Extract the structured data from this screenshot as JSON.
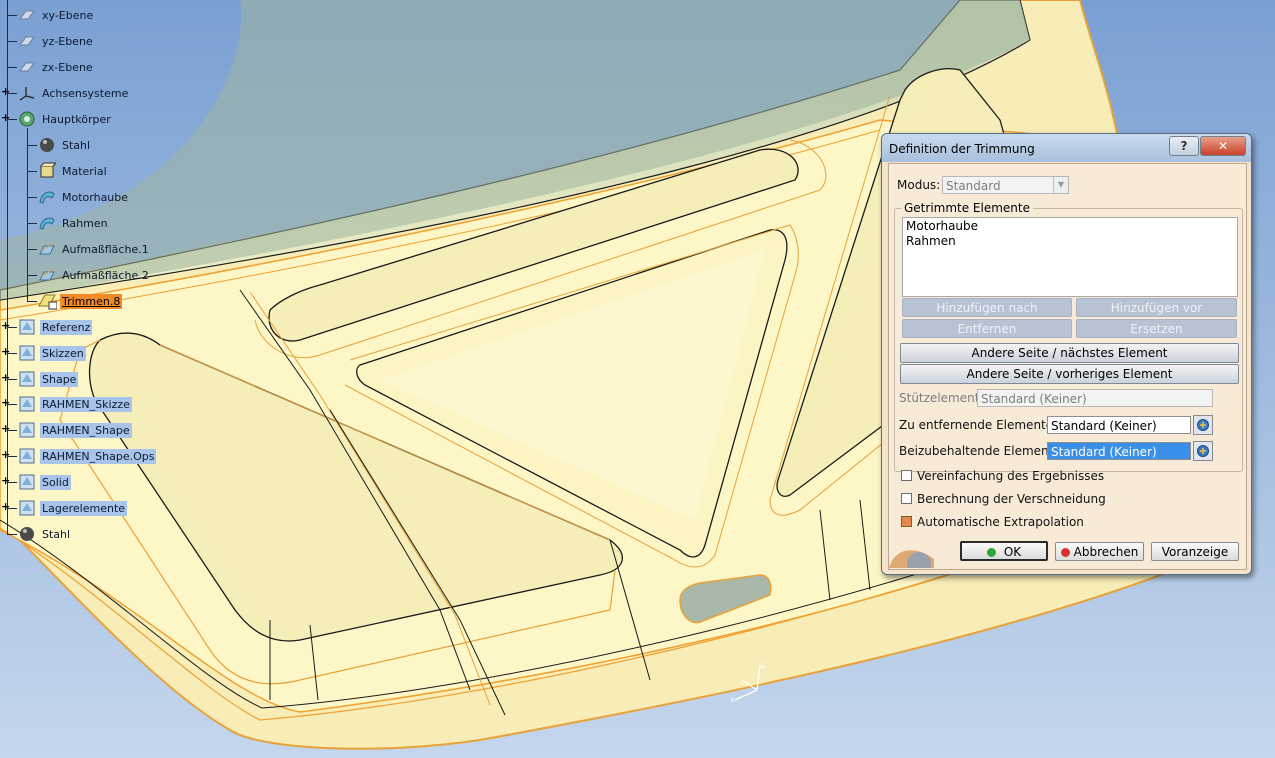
{
  "tree": {
    "items": [
      {
        "label": "xy-Ebene",
        "icon": "plane-icon"
      },
      {
        "label": "yz-Ebene",
        "icon": "plane-icon"
      },
      {
        "label": "zx-Ebene",
        "icon": "plane-icon"
      },
      {
        "label": "Achsensysteme",
        "icon": "axis-system-icon"
      },
      {
        "label": "Hauptkörper",
        "icon": "gear-body-icon"
      },
      {
        "label": "Stahl",
        "icon": "material-sphere-icon"
      },
      {
        "label": "Material",
        "icon": "material-box-icon"
      },
      {
        "label": "Motorhaube",
        "icon": "surface-icon"
      },
      {
        "label": "Rahmen",
        "icon": "surface-icon"
      },
      {
        "label": "Aufmaßfläche.1",
        "icon": "offset-surface-icon"
      },
      {
        "label": "Aufmaßfläche.2",
        "icon": "offset-surface-icon"
      },
      {
        "label": "Trimmen.8",
        "icon": "trim-icon"
      },
      {
        "label": "Referenz",
        "icon": "geometric-set-icon"
      },
      {
        "label": "Skizzen",
        "icon": "geometric-set-icon"
      },
      {
        "label": "Shape",
        "icon": "geometric-set-icon"
      },
      {
        "label": "RAHMEN_Skizze",
        "icon": "geometric-set-icon"
      },
      {
        "label": "RAHMEN_Shape",
        "icon": "geometric-set-icon"
      },
      {
        "label": "RAHMEN_Shape.Ops",
        "icon": "geometric-set-icon"
      },
      {
        "label": "Solid",
        "icon": "geometric-set-icon"
      },
      {
        "label": "Lagerelemente",
        "icon": "geometric-set-icon"
      },
      {
        "label": "Stahl",
        "icon": "material-sphere-icon"
      }
    ]
  },
  "dialog": {
    "title": "Definition der Trimmung",
    "help_glyph": "?",
    "close_glyph": "✕",
    "modus_label": "Modus:",
    "modus_value": "Standard",
    "group_label": "Getrimmte Elemente",
    "trimmed_elements": [
      "Motorhaube",
      "Rahmen"
    ],
    "add_after": "Hinzufügen nach",
    "add_before": "Hinzufügen vor",
    "remove": "Entfernen",
    "replace": "Ersetzen",
    "other_side_next": "Andere Seite / nächstes Element",
    "other_side_prev": "Andere Seite / vorheriges Element",
    "support_label": "Stützelement:",
    "support_value": "Standard (Keiner)",
    "remove_elements_label": "Zu entfernende Elemente:",
    "remove_elements_value": "Standard (Keiner)",
    "keep_elements_label": "Beizubehaltende Elemente:",
    "keep_elements_value": "Standard (Keiner)",
    "simplify_label": "Vereinfachung des Ergebnisses",
    "simplify_checked": false,
    "intersection_label": "Berechnung der Verschneidung",
    "intersection_checked": false,
    "extrapolation_label": "Automatische Extrapolation",
    "extrapolation_checked": true,
    "ok": "OK",
    "cancel": "Abbrechen",
    "preview": "Voranzeige"
  },
  "colors": {
    "background_top": "#7ea3d3",
    "background_bottom": "#c2d4ea",
    "surface_fill": "#fdf7c4",
    "edge_orange": "#f0a030",
    "selection_blue": "#3a8fe8",
    "active_orange": "#f28a2a"
  }
}
